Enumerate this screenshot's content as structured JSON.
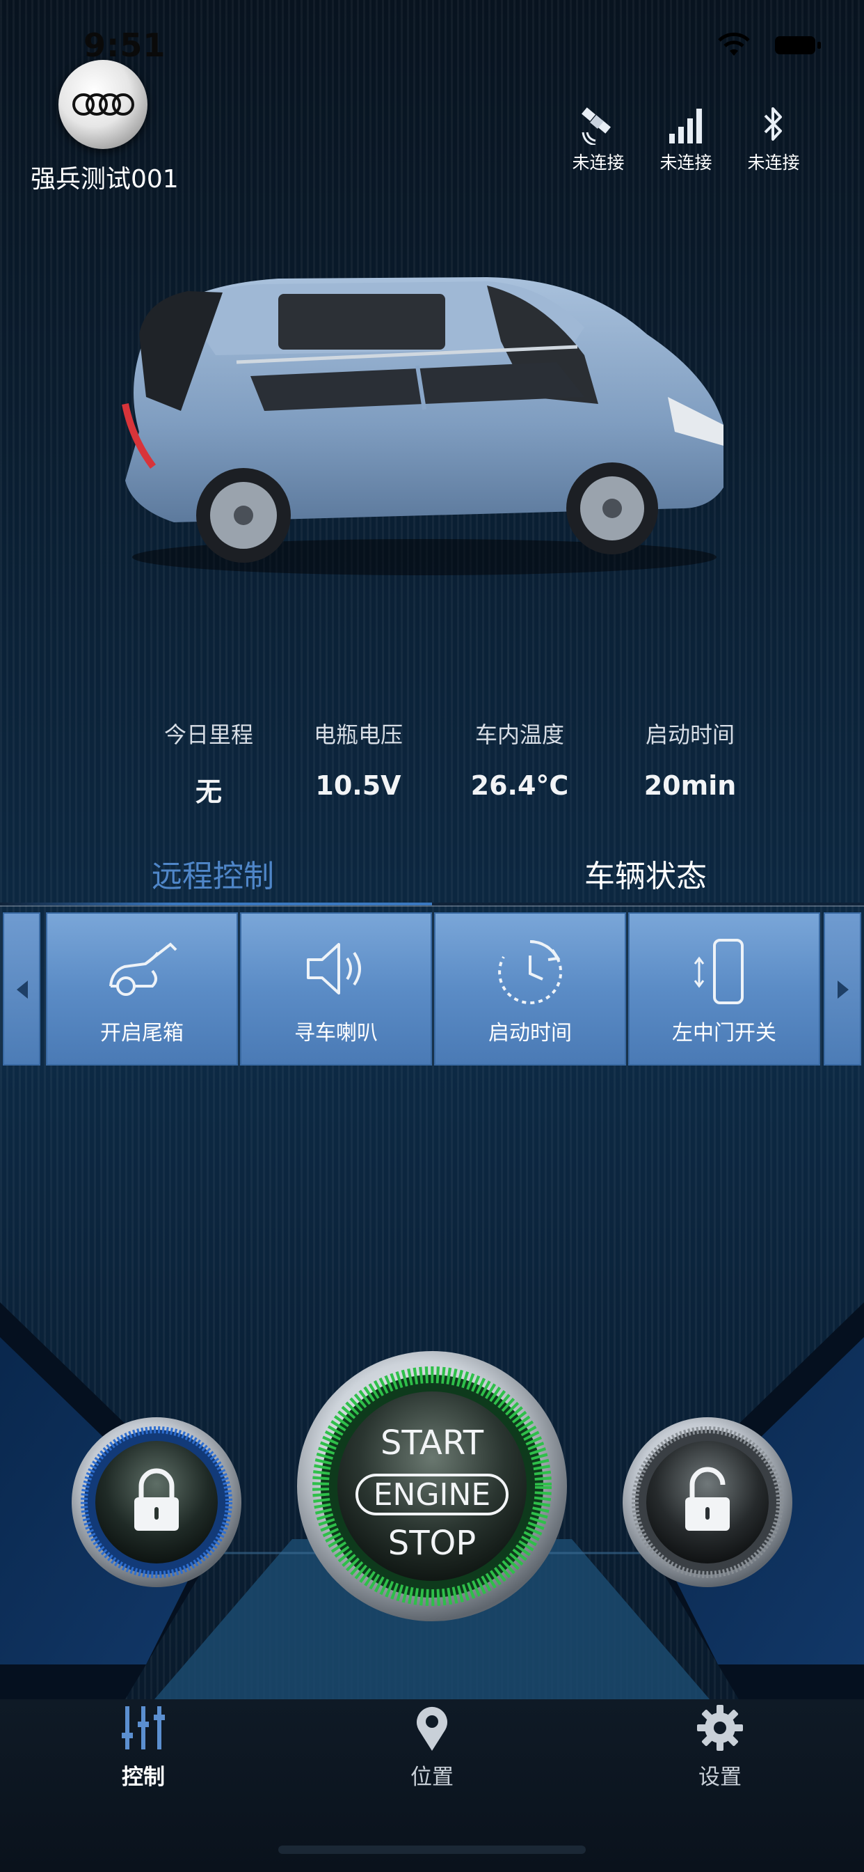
{
  "status_bar": {
    "time": "9:51"
  },
  "header": {
    "device_name": "强兵测试001",
    "connections": [
      {
        "icon": "satellite-icon",
        "label": "未连接"
      },
      {
        "icon": "signal-icon",
        "label": "未连接"
      },
      {
        "icon": "bluetooth-icon",
        "label": "未连接"
      }
    ]
  },
  "stats": [
    {
      "label": "今日里程",
      "value": "无"
    },
    {
      "label": "电瓶电压",
      "value": "10.5V"
    },
    {
      "label": "车内温度",
      "value": "26.4°C"
    },
    {
      "label": "启动时间",
      "value": "20min"
    }
  ],
  "tabs": [
    {
      "label": "远程控制",
      "active": true
    },
    {
      "label": "车辆状态",
      "active": false
    }
  ],
  "controls": [
    {
      "icon": "trunk-open-icon",
      "label": "开启尾箱"
    },
    {
      "icon": "horn-speaker-icon",
      "label": "寻车喇叭"
    },
    {
      "icon": "clock-timer-icon",
      "label": "启动时间"
    },
    {
      "icon": "phone-door-icon",
      "label": "左中门开关"
    }
  ],
  "engine_button": {
    "line1": "START",
    "line2": "ENGINE",
    "line3": "STOP"
  },
  "nav": [
    {
      "icon": "sliders-icon",
      "label": "控制",
      "active": true
    },
    {
      "icon": "location-pin-icon",
      "label": "位置",
      "active": false
    },
    {
      "icon": "gear-icon",
      "label": "设置",
      "active": false
    }
  ],
  "colors": {
    "accent": "#4f86c8",
    "control_button": "#5b8cc6",
    "engine_ring": "#2fbf4a",
    "car_body": "#8aa7c9"
  }
}
